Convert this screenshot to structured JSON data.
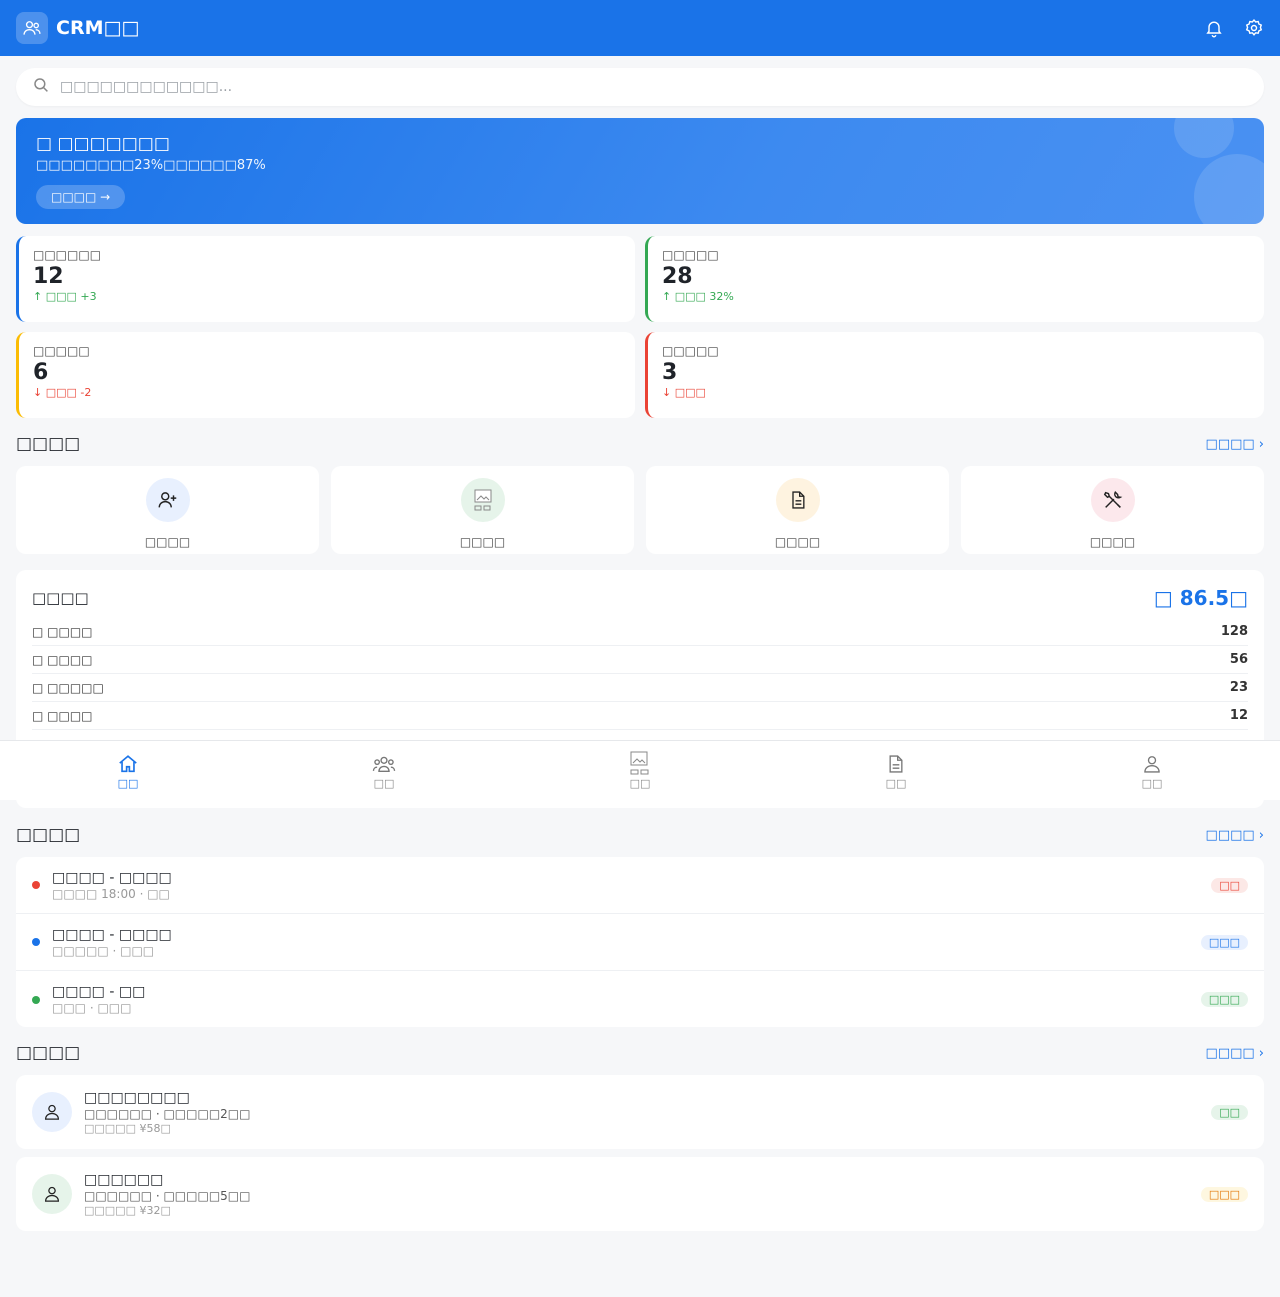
{
  "header": {
    "title": "CRM□□",
    "icons": [
      "users-icon",
      "bell-icon",
      "gear-icon"
    ]
  },
  "search": {
    "placeholder": "□□□□□□□□□□□□..."
  },
  "banner": {
    "title": "□ □□□□□□□",
    "subtitle": "□□□□□□□□23%□□□□□□87%",
    "button": "□□□□ →"
  },
  "stats": [
    {
      "label": "□□□□□□",
      "value": "12",
      "trend": "↑ □□□ +3",
      "color": "#1a73e8",
      "trend_color": "#34a853"
    },
    {
      "label": "□□□□□",
      "value": "28",
      "trend": "↑ □□□ 32%",
      "color": "#34a853",
      "trend_color": "#34a853"
    },
    {
      "label": "□□□□□",
      "value": "6",
      "trend": "↓ □□□ -2",
      "color": "#fbbc04",
      "trend_color": "#ea4335"
    },
    {
      "label": "□□□□□",
      "value": "3",
      "trend": "↓ □□□",
      "color": "#ea4335",
      "trend_color": "#ea4335"
    }
  ],
  "quick": {
    "title": "□□□□",
    "more": "□□□□ ›",
    "items": [
      {
        "label": "□□□□",
        "icon": "add-user-icon",
        "bg": "#e8f0fe"
      },
      {
        "label": "□□□□",
        "icon": "broken-image-icon",
        "bg": "#e6f4ea"
      },
      {
        "label": "□□□□",
        "icon": "document-icon",
        "bg": "#fef3e0"
      },
      {
        "label": "□□□□",
        "icon": "tools-icon",
        "bg": "#fce8ec"
      }
    ]
  },
  "performance": {
    "title": "□□□□",
    "total": "□ 86.5□",
    "rows": [
      {
        "label": "□ □□□□",
        "value": "128"
      },
      {
        "label": "□ □□□□",
        "value": "56"
      },
      {
        "label": "□ □□□□□",
        "value": "23"
      },
      {
        "label": "□ □□□□",
        "value": "12"
      }
    ]
  },
  "bottom_nav": [
    {
      "label": "□□",
      "icon": "home-icon",
      "active": true
    },
    {
      "label": "□□",
      "icon": "team-icon",
      "active": false
    },
    {
      "label": "□□",
      "icon": "broken-image-icon",
      "active": false
    },
    {
      "label": "□□",
      "icon": "document-icon",
      "active": false
    },
    {
      "label": "□□",
      "icon": "person-icon",
      "active": false
    }
  ],
  "todos": {
    "title": "□□□□",
    "more": "□□□□ ›",
    "items": [
      {
        "title": "□□□□ - □□□□",
        "sub": "□□□□ 18:00 · □□",
        "tag": "□□",
        "dot": "#ea4335",
        "tag_bg": "#fce8e6",
        "tag_color": "#ea4335"
      },
      {
        "title": "□□□□ - □□□□",
        "sub": "□□□□□ · □□□",
        "tag": "□□□",
        "dot": "#1a73e8",
        "tag_bg": "#e8f0fe",
        "tag_color": "#1a73e8"
      },
      {
        "title": "□□□□ - □□",
        "sub": "□□□ · □□□",
        "tag": "□□□",
        "dot": "#34a853",
        "tag_bg": "#e6f4ea",
        "tag_color": "#34a853"
      }
    ]
  },
  "customers": {
    "title": "□□□□",
    "more": "□□□□ ›",
    "items": [
      {
        "name": "□□□□□□□□",
        "sub": "□□□□□□ · □□□□□2□□",
        "amount": "□□□□□ ¥58□",
        "tag": "□□",
        "avatar_bg": "#e8f0fe",
        "tag_bg": "#e6f4ea",
        "tag_color": "#34a853"
      },
      {
        "name": "□□□□□□",
        "sub": "□□□□□□ · □□□□□5□□",
        "amount": "□□□□□ ¥32□",
        "tag": "□□□",
        "avatar_bg": "#e6f4ea",
        "tag_bg": "#fef7e0",
        "tag_color": "#e37400"
      }
    ]
  }
}
